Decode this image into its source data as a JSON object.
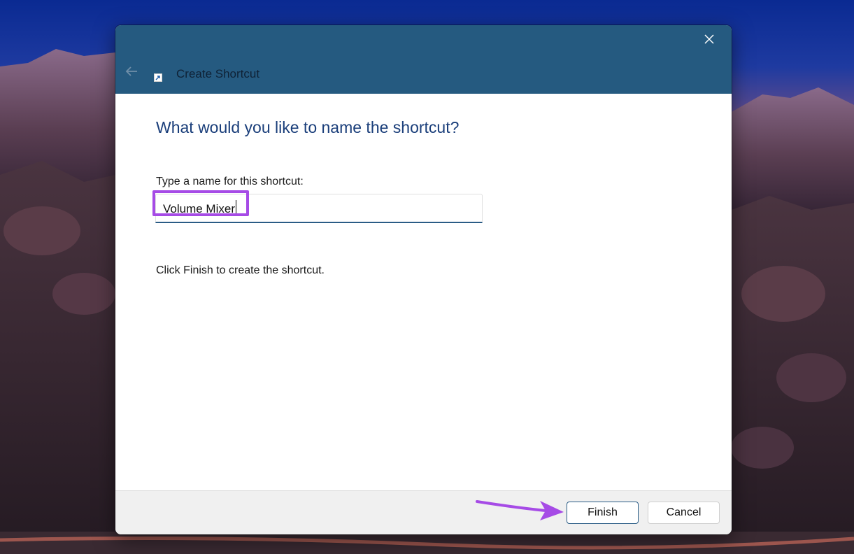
{
  "window": {
    "title": "Create Shortcut",
    "heading": "What would you like to name the shortcut?",
    "field_label": "Type a name for this shortcut:",
    "input_value": "Volume Mixer",
    "info_text": "Click Finish to create the shortcut."
  },
  "buttons": {
    "finish": "Finish",
    "cancel": "Cancel"
  },
  "icons": {
    "back": "back-arrow-icon",
    "close": "close-icon",
    "app": "shortcut-icon"
  },
  "colors": {
    "titlebar": "#255a80",
    "heading": "#1a3e7a",
    "accent": "#2a5c86",
    "annotation": "#a64be6"
  }
}
